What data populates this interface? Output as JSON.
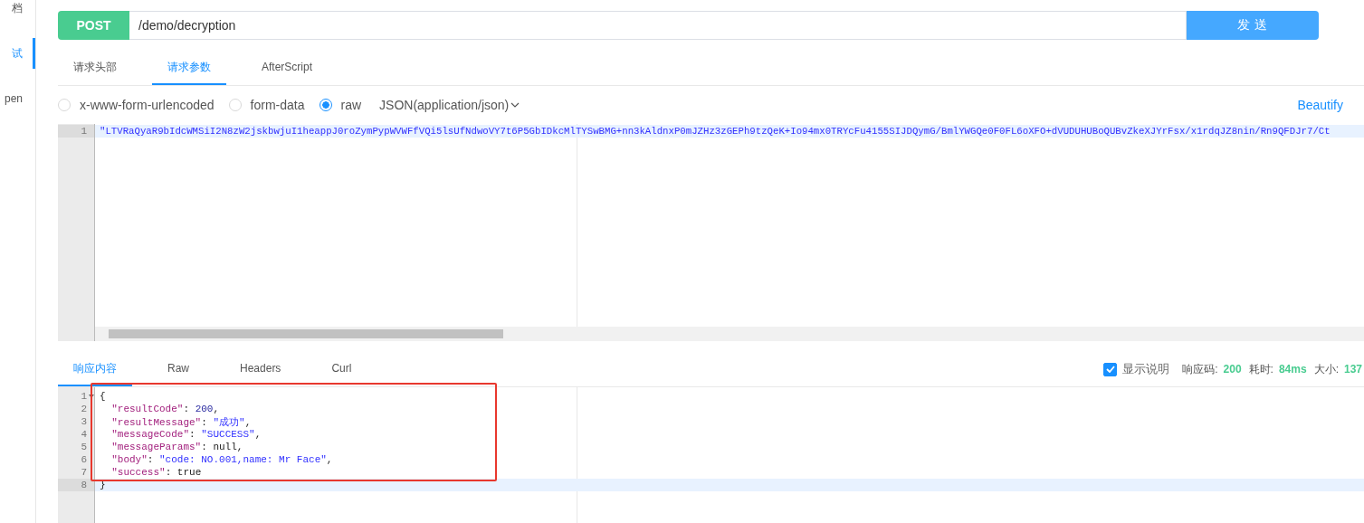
{
  "sidebar": {
    "items": [
      {
        "label": "档",
        "selected": false
      },
      {
        "label": "试",
        "selected": true
      },
      {
        "label": "pen",
        "selected": false
      }
    ]
  },
  "request": {
    "method": "POST",
    "url": "/demo/decryption",
    "send_button": "发 送"
  },
  "request_tabs": [
    {
      "label": "请求头部",
      "selected": false
    },
    {
      "label": "请求参数",
      "selected": true
    },
    {
      "label": "AfterScript",
      "selected": false
    }
  ],
  "body_types": [
    {
      "label": "x-www-form-urlencoded",
      "selected": false
    },
    {
      "label": "form-data",
      "selected": false
    },
    {
      "label": "raw",
      "selected": true
    }
  ],
  "content_type": "JSON(application/json)",
  "beautify": "Beautify",
  "request_editor": {
    "lines": [
      {
        "number": "1",
        "active": true,
        "text": "\"LTVRaQyaR9bIdcWMSiI2N8zW2jskbwjuI1heappJ0roZymPypWVWFfVQi5lsUfNdwoVY7t6P5GbIDkcMlTYSwBMG+nn3kAldnxP0mJZHz3zGEPh9tzQeK+Io94mx0TRYcFu4155SIJDQymG/BmlYWGQe0F0FL6oXFO+dVUDUHUBoQUBvZkeXJYrFsx/x1rdqJZ8nin/Rn9QFDJr7/Ct"
      }
    ]
  },
  "response_tabs": [
    {
      "label": "响应内容",
      "selected": true
    },
    {
      "label": "Raw",
      "selected": false
    },
    {
      "label": "Headers",
      "selected": false
    },
    {
      "label": "Curl",
      "selected": false
    }
  ],
  "show_description": {
    "label": "显示说明",
    "checked": true
  },
  "stats": [
    {
      "label": "响应码:",
      "value": "200"
    },
    {
      "label": "耗时:",
      "value": "84ms"
    },
    {
      "label": "大小:",
      "value": "137"
    }
  ],
  "response_editor": {
    "lines": [
      {
        "number": "1",
        "active": false,
        "foldable": true,
        "tokens": [
          {
            "kind": "punct",
            "text": "{"
          }
        ]
      },
      {
        "number": "2",
        "active": false,
        "foldable": false,
        "tokens": [
          {
            "kind": "key",
            "text": "  \"resultCode\""
          },
          {
            "kind": "punct",
            "text": ": "
          },
          {
            "kind": "number",
            "text": "200"
          },
          {
            "kind": "punct",
            "text": ","
          }
        ]
      },
      {
        "number": "3",
        "active": false,
        "foldable": false,
        "tokens": [
          {
            "kind": "key",
            "text": "  \"resultMessage\""
          },
          {
            "kind": "punct",
            "text": ": "
          },
          {
            "kind": "string",
            "text": "\"成功\""
          },
          {
            "kind": "punct",
            "text": ","
          }
        ]
      },
      {
        "number": "4",
        "active": false,
        "foldable": false,
        "tokens": [
          {
            "kind": "key",
            "text": "  \"messageCode\""
          },
          {
            "kind": "punct",
            "text": ": "
          },
          {
            "kind": "string",
            "text": "\"SUCCESS\""
          },
          {
            "kind": "punct",
            "text": ","
          }
        ]
      },
      {
        "number": "5",
        "active": false,
        "foldable": false,
        "tokens": [
          {
            "kind": "key",
            "text": "  \"messageParams\""
          },
          {
            "kind": "punct",
            "text": ": "
          },
          {
            "kind": "literal",
            "text": "null"
          },
          {
            "kind": "punct",
            "text": ","
          }
        ]
      },
      {
        "number": "6",
        "active": false,
        "foldable": false,
        "tokens": [
          {
            "kind": "key",
            "text": "  \"body\""
          },
          {
            "kind": "punct",
            "text": ": "
          },
          {
            "kind": "string",
            "text": "\"code: NO.001,name: Mr Face\""
          },
          {
            "kind": "punct",
            "text": ","
          }
        ]
      },
      {
        "number": "7",
        "active": false,
        "foldable": false,
        "tokens": [
          {
            "kind": "key",
            "text": "  \"success\""
          },
          {
            "kind": "punct",
            "text": ": "
          },
          {
            "kind": "literal",
            "text": "true"
          }
        ]
      },
      {
        "number": "8",
        "active": true,
        "foldable": false,
        "tokens": [
          {
            "kind": "punct",
            "text": "}"
          }
        ]
      }
    ]
  }
}
